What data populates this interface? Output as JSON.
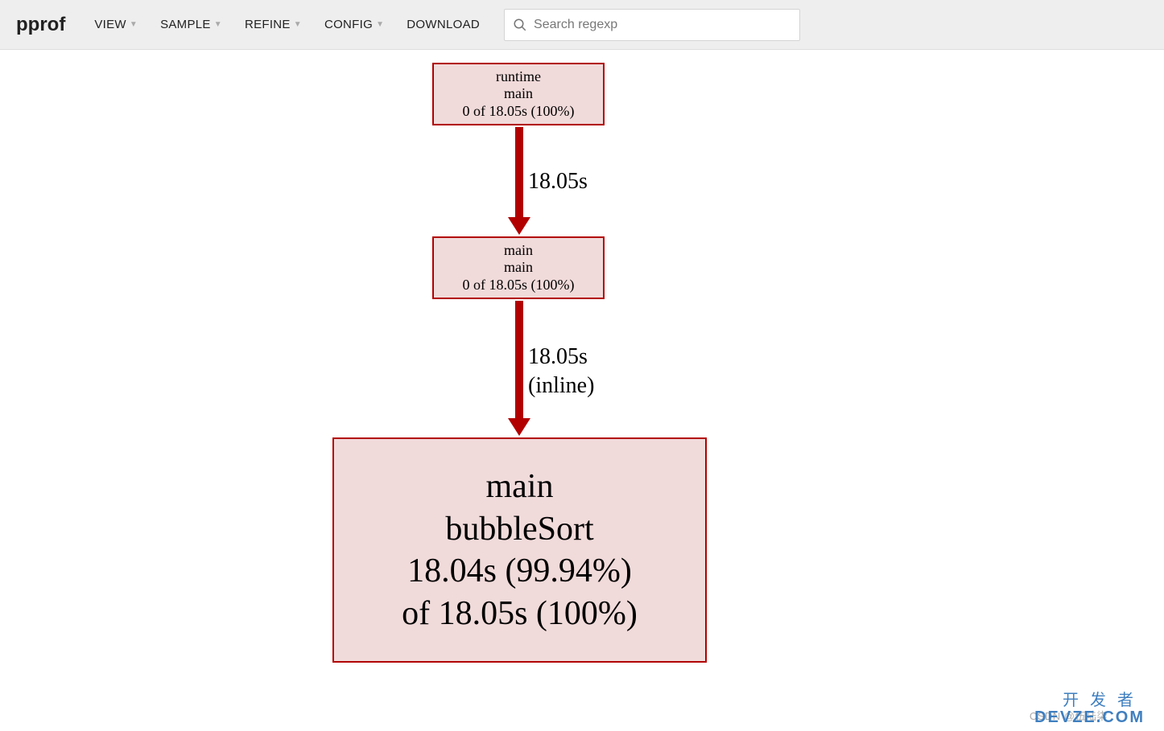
{
  "toolbar": {
    "brand": "pprof",
    "menu": {
      "view": "VIEW",
      "sample": "SAMPLE",
      "refine": "REFINE",
      "config": "CONFIG",
      "download": "DOWNLOAD"
    },
    "search_placeholder": "Search regexp"
  },
  "graph": {
    "nodes": {
      "n1": {
        "package": "runtime",
        "func": "main",
        "stat": "0 of 18.05s (100%)"
      },
      "n2": {
        "package": "main",
        "func": "main",
        "stat": "0 of 18.05s (100%)"
      },
      "n3": {
        "package": "main",
        "func": "bubbleSort",
        "stat1": "18.04s (99.94%)",
        "stat2": "of 18.05s (100%)"
      }
    },
    "edges": {
      "e1": {
        "weight": "18.05s"
      },
      "e2": {
        "weight": "18.05s",
        "inline": "(inline)"
      }
    }
  },
  "watermarks": {
    "csdn": "CSDN @伍陆柒",
    "devze1": "开发者",
    "devze2": "DEVZE.COM"
  }
}
